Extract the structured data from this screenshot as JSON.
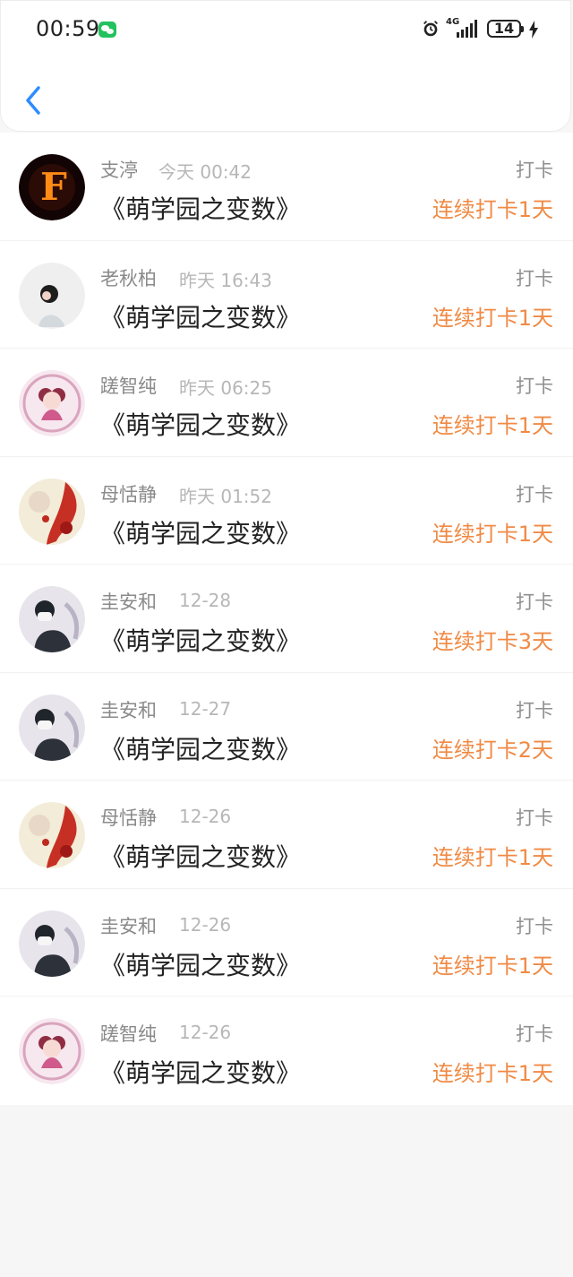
{
  "status_bar": {
    "time": "00:59",
    "network": "4G",
    "battery_level": "14"
  },
  "nav": {
    "back_label": ""
  },
  "rows": [
    {
      "name": "支渟",
      "time": "今天 00:42",
      "title": "《萌学园之变数》",
      "action": "打卡",
      "streak": "连续打卡1天",
      "avatar": "avatar-fire-f"
    },
    {
      "name": "老秋柏",
      "time": "昨天 16:43",
      "title": "《萌学园之变数》",
      "action": "打卡",
      "streak": "连续打卡1天",
      "avatar": "avatar-boy"
    },
    {
      "name": "蹉智纯",
      "time": "昨天 06:25",
      "title": "《萌学园之变数》",
      "action": "打卡",
      "streak": "连续打卡1天",
      "avatar": "avatar-anime-pink"
    },
    {
      "name": "母恬静",
      "time": "昨天 01:52",
      "title": "《萌学园之变数》",
      "action": "打卡",
      "streak": "连续打卡1天",
      "avatar": "avatar-red-anime"
    },
    {
      "name": "圭安和",
      "time": "12-28",
      "title": "《萌学园之变数》",
      "action": "打卡",
      "streak": "连续打卡3天",
      "avatar": "avatar-mask"
    },
    {
      "name": "圭安和",
      "time": "12-27",
      "title": "《萌学园之变数》",
      "action": "打卡",
      "streak": "连续打卡2天",
      "avatar": "avatar-mask"
    },
    {
      "name": "母恬静",
      "time": "12-26",
      "title": "《萌学园之变数》",
      "action": "打卡",
      "streak": "连续打卡1天",
      "avatar": "avatar-red-anime"
    },
    {
      "name": "圭安和",
      "time": "12-26",
      "title": "《萌学园之变数》",
      "action": "打卡",
      "streak": "连续打卡1天",
      "avatar": "avatar-mask"
    },
    {
      "name": "蹉智纯",
      "time": "12-26",
      "title": "《萌学园之变数》",
      "action": "打卡",
      "streak": "连续打卡1天",
      "avatar": "avatar-anime-pink"
    }
  ],
  "colors": {
    "accent": "#f08a45",
    "back": "#2d8cff"
  }
}
